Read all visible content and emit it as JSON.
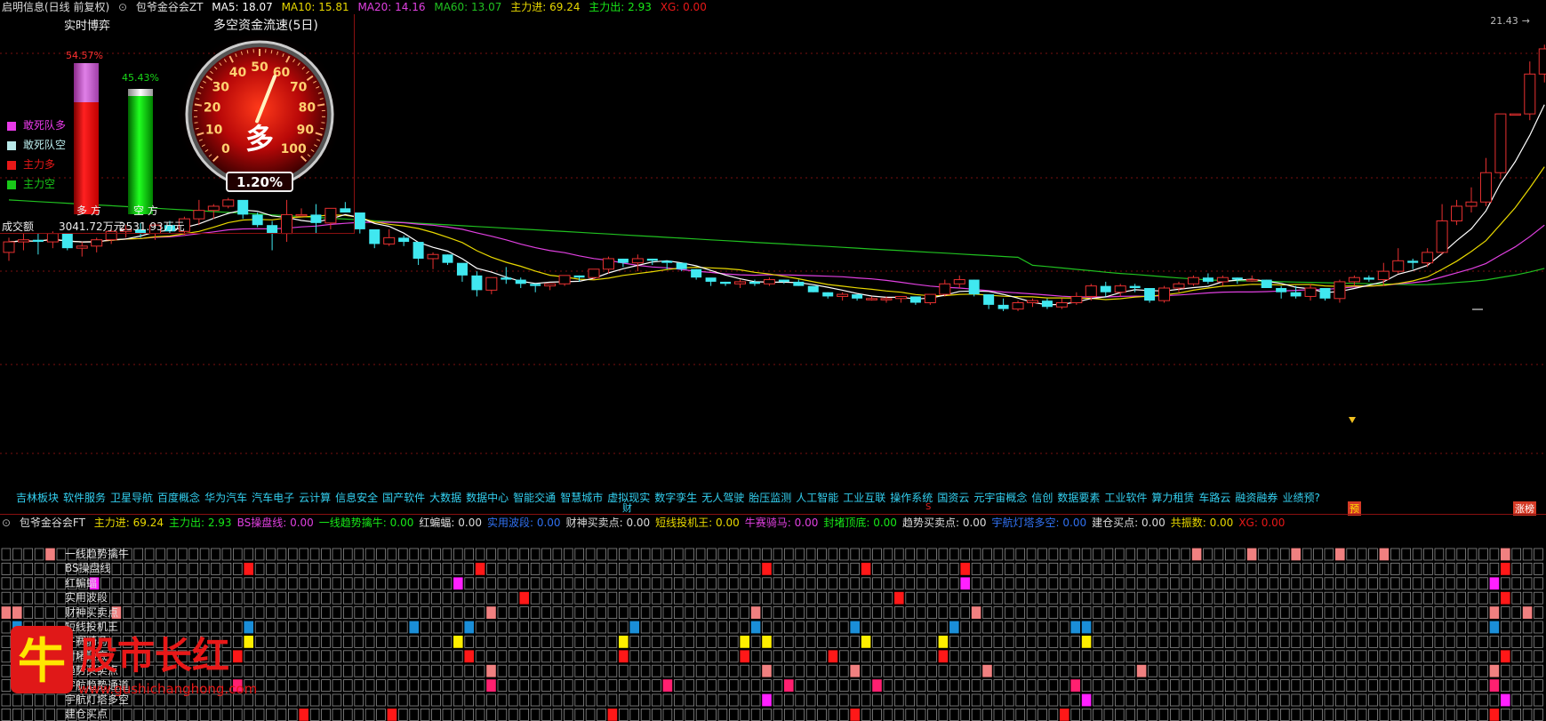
{
  "window_title": {
    "app": "启明信息(日线 前复权)",
    "indicator": "包爷金谷会ZT",
    "ma5_label": "MA5:",
    "ma5": "18.07",
    "ma10_label": "MA10:",
    "ma10": "15.81",
    "ma20_label": "MA20:",
    "ma20": "14.16",
    "ma60_label": "MA60:",
    "ma60": "13.07",
    "zl_in_label": "主力进:",
    "zl_in": "69.24",
    "zl_out_label": "主力出:",
    "zl_out": "2.93",
    "xg_label": "XG:",
    "xg": "0.00"
  },
  "top_price": "21.43",
  "left_panel": {
    "title": "实时博弈",
    "bull_pct": "54.57%",
    "bear_pct": "45.43%",
    "bull_fill": 0.5457,
    "bear_fill": 0.4543,
    "legend": [
      {
        "label": "敢死队多",
        "color": "#e83ae8"
      },
      {
        "label": "敢死队空",
        "color": "#b8e8e8"
      },
      {
        "label": "主力多",
        "color": "#e81818"
      },
      {
        "label": "主力空",
        "color": "#18c818"
      }
    ],
    "bull_label": "多 方",
    "bear_label": "空 方",
    "volume_label": "成交额",
    "bull_amount": "3041.72万元",
    "bear_amount": "2531.93万元"
  },
  "gauge": {
    "title": "多空资金流速(5日)",
    "ticks": [
      "0",
      "10",
      "20",
      "30",
      "40",
      "50",
      "60",
      "70",
      "80",
      "90",
      "100"
    ],
    "center_text": "多",
    "percent": "1.20%",
    "needle_value": 58
  },
  "main_chart": {
    "colors": {
      "up": "#e83030",
      "down": "#40e8f0",
      "ma5": "#ffffff",
      "ma10": "#e8d800",
      "ma20": "#e040e0",
      "ma60": "#20c020"
    },
    "candles": [
      [
        11.7,
        12.4,
        11.3,
        12.2
      ],
      [
        12.2,
        12.6,
        11.8,
        12.3
      ],
      [
        12.3,
        12.6,
        11.6,
        12.2
      ],
      [
        12.2,
        12.7,
        11.9,
        12.6
      ],
      [
        12.6,
        12.5,
        11.8,
        11.9
      ],
      [
        11.9,
        12.2,
        11.5,
        12.0
      ],
      [
        12.0,
        12.4,
        11.7,
        12.3
      ],
      [
        12.3,
        12.8,
        12.1,
        12.7
      ],
      [
        12.7,
        13.0,
        12.4,
        12.8
      ],
      [
        12.8,
        13.1,
        12.4,
        12.6
      ],
      [
        12.6,
        13.1,
        12.3,
        13.0
      ],
      [
        13.0,
        13.2,
        12.6,
        12.7
      ],
      [
        12.7,
        13.4,
        12.5,
        13.3
      ],
      [
        13.3,
        14.2,
        13.0,
        13.7
      ],
      [
        13.7,
        14.0,
        13.3,
        13.9
      ],
      [
        13.9,
        14.3,
        13.8,
        14.2
      ],
      [
        14.2,
        14.0,
        13.3,
        13.5
      ],
      [
        13.5,
        13.6,
        12.9,
        13.0
      ],
      [
        13.0,
        13.2,
        11.8,
        12.6
      ],
      [
        12.6,
        14.2,
        12.2,
        13.5
      ],
      [
        13.5,
        13.8,
        13.4,
        13.5
      ],
      [
        13.5,
        14.0,
        12.6,
        13.1
      ],
      [
        13.1,
        13.8,
        12.8,
        13.8
      ],
      [
        13.8,
        14.1,
        13.7,
        13.6
      ],
      [
        13.6,
        13.5,
        12.6,
        12.8
      ],
      [
        12.8,
        12.7,
        11.9,
        12.1
      ],
      [
        12.1,
        12.8,
        12.0,
        12.4
      ],
      [
        12.4,
        12.5,
        12.0,
        12.2
      ],
      [
        12.2,
        12.0,
        11.1,
        11.4
      ],
      [
        11.4,
        11.7,
        10.9,
        11.6
      ],
      [
        11.6,
        11.6,
        11.1,
        11.2
      ],
      [
        11.2,
        11.0,
        10.3,
        10.6
      ],
      [
        10.6,
        10.8,
        9.6,
        9.9
      ],
      [
        9.9,
        10.5,
        9.7,
        10.5
      ],
      [
        10.5,
        11.0,
        10.2,
        10.4
      ],
      [
        10.4,
        10.5,
        10.0,
        10.2
      ],
      [
        10.2,
        10.2,
        9.8,
        10.1
      ],
      [
        10.1,
        10.2,
        9.9,
        10.2
      ],
      [
        10.2,
        10.6,
        10.1,
        10.6
      ],
      [
        10.6,
        10.6,
        10.3,
        10.5
      ],
      [
        10.5,
        10.9,
        10.4,
        10.9
      ],
      [
        10.9,
        11.5,
        10.7,
        11.4
      ],
      [
        11.4,
        11.4,
        11.0,
        11.2
      ],
      [
        11.2,
        11.6,
        10.8,
        11.4
      ],
      [
        11.4,
        11.4,
        11.1,
        11.3
      ],
      [
        11.3,
        11.2,
        10.9,
        11.2
      ],
      [
        11.2,
        11.1,
        10.8,
        10.9
      ],
      [
        10.9,
        10.9,
        10.4,
        10.5
      ],
      [
        10.5,
        10.4,
        10.1,
        10.3
      ],
      [
        10.3,
        10.3,
        10.1,
        10.2
      ],
      [
        10.2,
        10.4,
        10.0,
        10.3
      ],
      [
        10.3,
        10.4,
        10.1,
        10.2
      ],
      [
        10.2,
        10.5,
        10.1,
        10.4
      ],
      [
        10.4,
        10.4,
        10.2,
        10.3
      ],
      [
        10.3,
        10.4,
        10.1,
        10.1
      ],
      [
        10.1,
        10.1,
        9.8,
        9.8
      ],
      [
        9.8,
        9.8,
        9.5,
        9.6
      ],
      [
        9.6,
        9.8,
        9.4,
        9.7
      ],
      [
        9.7,
        9.7,
        9.4,
        9.5
      ],
      [
        9.5,
        9.6,
        9.4,
        9.5
      ],
      [
        9.5,
        9.6,
        9.3,
        9.5
      ],
      [
        9.5,
        9.6,
        9.3,
        9.6
      ],
      [
        9.6,
        9.6,
        9.2,
        9.3
      ],
      [
        9.3,
        9.7,
        9.2,
        9.7
      ],
      [
        9.7,
        10.4,
        9.6,
        10.2
      ],
      [
        10.2,
        10.6,
        10.0,
        10.4
      ],
      [
        10.4,
        10.4,
        9.6,
        9.7
      ],
      [
        9.7,
        9.7,
        9.0,
        9.2
      ],
      [
        9.2,
        9.5,
        8.9,
        9.0
      ],
      [
        9.0,
        9.4,
        8.9,
        9.3
      ],
      [
        9.3,
        9.5,
        9.1,
        9.4
      ],
      [
        9.4,
        9.5,
        9.0,
        9.1
      ],
      [
        9.1,
        9.5,
        9.0,
        9.3
      ],
      [
        9.3,
        9.8,
        9.2,
        9.6
      ],
      [
        9.6,
        10.2,
        9.4,
        10.1
      ],
      [
        10.1,
        10.3,
        9.6,
        9.8
      ],
      [
        9.8,
        10.2,
        9.6,
        10.1
      ],
      [
        10.1,
        10.2,
        9.8,
        10.0
      ],
      [
        10.0,
        9.9,
        9.3,
        9.4
      ],
      [
        9.4,
        10.1,
        9.3,
        10.0
      ],
      [
        10.0,
        10.3,
        9.8,
        10.2
      ],
      [
        10.2,
        10.6,
        10.1,
        10.5
      ],
      [
        10.5,
        10.7,
        10.2,
        10.3
      ],
      [
        10.3,
        10.6,
        10.1,
        10.5
      ],
      [
        10.5,
        10.5,
        10.2,
        10.4
      ],
      [
        10.4,
        10.6,
        10.3,
        10.4
      ],
      [
        10.4,
        10.4,
        10.0,
        10.0
      ],
      [
        10.0,
        10.1,
        9.5,
        9.8
      ],
      [
        9.8,
        10.1,
        9.5,
        9.6
      ],
      [
        9.6,
        10.2,
        9.4,
        10.0
      ],
      [
        10.0,
        10.0,
        9.4,
        9.5
      ],
      [
        9.5,
        10.4,
        9.3,
        10.3
      ],
      [
        10.3,
        10.6,
        10.1,
        10.5
      ],
      [
        10.5,
        10.6,
        10.3,
        10.4
      ],
      [
        10.4,
        11.2,
        10.1,
        10.8
      ],
      [
        10.8,
        11.9,
        10.7,
        11.3
      ],
      [
        11.3,
        11.4,
        10.9,
        11.2
      ],
      [
        11.2,
        11.9,
        11.0,
        11.7
      ],
      [
        11.7,
        14.0,
        11.6,
        13.2
      ],
      [
        13.2,
        14.2,
        13.0,
        13.9
      ],
      [
        13.9,
        14.8,
        13.6,
        14.1
      ],
      [
        14.1,
        16.2,
        13.9,
        15.5
      ],
      [
        15.5,
        18.3,
        15.2,
        18.3
      ],
      [
        18.3,
        18.3,
        18.3,
        18.3
      ],
      [
        18.3,
        20.8,
        18.0,
        20.2
      ],
      [
        20.2,
        21.6,
        19.8,
        21.4
      ]
    ],
    "sectors": [
      "吉林板块",
      "软件服务",
      "卫星导航",
      "百度概念",
      "华为汽车",
      "汽车电子",
      "云计算",
      "信息安全",
      "国产软件",
      "大数据",
      "数据中心",
      "智能交通",
      "智慧城市",
      "虚拟现实",
      "数字孪生",
      "无人驾驶",
      "胎压监测",
      "人工智能",
      "工业互联",
      "操作系统",
      "国资云",
      "元宇宙概念",
      "信创",
      "数据要素",
      "工业软件",
      "算力租赁",
      "车路云",
      "融资融券",
      "业绩预?"
    ],
    "marker_cai": "财",
    "marker_s": "S",
    "marker_yu": "预",
    "marker_zb": "涨榜"
  },
  "sub_chart": {
    "title": "包爷金谷会FT",
    "values": [
      {
        "label": "主力进:",
        "value": "69.24",
        "color": "#e8d800"
      },
      {
        "label": "主力出:",
        "value": "2.93",
        "color": "#18e818"
      },
      {
        "label": "BS操盘线:",
        "value": "0.00",
        "color": "#e040e0"
      },
      {
        "label": "一线趋势擒牛:",
        "value": "0.00",
        "color": "#18e818"
      },
      {
        "label": "红蝙蝠:",
        "value": "0.00",
        "color": "#dddddd"
      },
      {
        "label": "实用波段:",
        "value": "0.00",
        "color": "#3070f0"
      },
      {
        "label": "财神买卖点:",
        "value": "0.00",
        "color": "#dddddd"
      },
      {
        "label": "短线投机王:",
        "value": "0.00",
        "color": "#e8d800"
      },
      {
        "label": "牛赛骑马:",
        "value": "0.00",
        "color": "#e040e0"
      },
      {
        "label": "封堵顶底:",
        "value": "0.00",
        "color": "#18e818"
      },
      {
        "label": "趋势买卖点:",
        "value": "0.00",
        "color": "#dddddd"
      },
      {
        "label": "宇航灯塔多空:",
        "value": "0.00",
        "color": "#3070f0"
      },
      {
        "label": "建仓买点:",
        "value": "0.00",
        "color": "#dddddd"
      },
      {
        "label": "共振数:",
        "value": "0.00",
        "color": "#e8d800"
      },
      {
        "label": "XG:",
        "value": "0.00",
        "color": "#e81818"
      }
    ],
    "rows": [
      {
        "label": "一线趋势擒牛",
        "color": "#f08080",
        "hits": [
          4,
          108,
          113,
          117,
          121,
          125,
          136
        ]
      },
      {
        "label": "BS操盘线",
        "color": "#ff1818",
        "hits": [
          22,
          43,
          69,
          78,
          87,
          136
        ]
      },
      {
        "label": "红蝙蝠",
        "color": "#ff20ff",
        "hits": [
          8,
          41,
          87,
          135
        ]
      },
      {
        "label": "实用波段",
        "color": "#ff1818",
        "hits": [
          47,
          81,
          136
        ]
      },
      {
        "label": "财神买卖点",
        "color": "#f08080",
        "hits": [
          0,
          1,
          10,
          44,
          68,
          88,
          135,
          138
        ]
      },
      {
        "label": "短线投机王",
        "color": "#1a8ed8",
        "hits": [
          1,
          22,
          37,
          42,
          57,
          68,
          77,
          86,
          97,
          98,
          135
        ]
      },
      {
        "label": "牛赛骑马",
        "color": "#ffee00",
        "hits": [
          22,
          41,
          56,
          67,
          69,
          78,
          85,
          98
        ]
      },
      {
        "label": "封堵顶底",
        "color": "#ff1818",
        "hits": [
          21,
          42,
          56,
          67,
          75,
          85,
          136
        ]
      },
      {
        "label": "趋势买卖点",
        "color": "#f08080",
        "hits": [
          44,
          69,
          77,
          89,
          103,
          135
        ]
      },
      {
        "label": "宇航趋势通道",
        "color": "#ff2070",
        "hits": [
          21,
          44,
          60,
          71,
          79,
          97,
          135
        ]
      },
      {
        "label": "宇航灯塔多空",
        "color": "#ff20ff",
        "hits": [
          69,
          98,
          136
        ]
      },
      {
        "label": "建仓买点",
        "color": "#ff1818",
        "hits": [
          27,
          35,
          55,
          77,
          96,
          135
        ]
      }
    ]
  },
  "watermark": {
    "char": "牛",
    "text": "股市长红",
    "url": "www.gushichanghong.com"
  }
}
